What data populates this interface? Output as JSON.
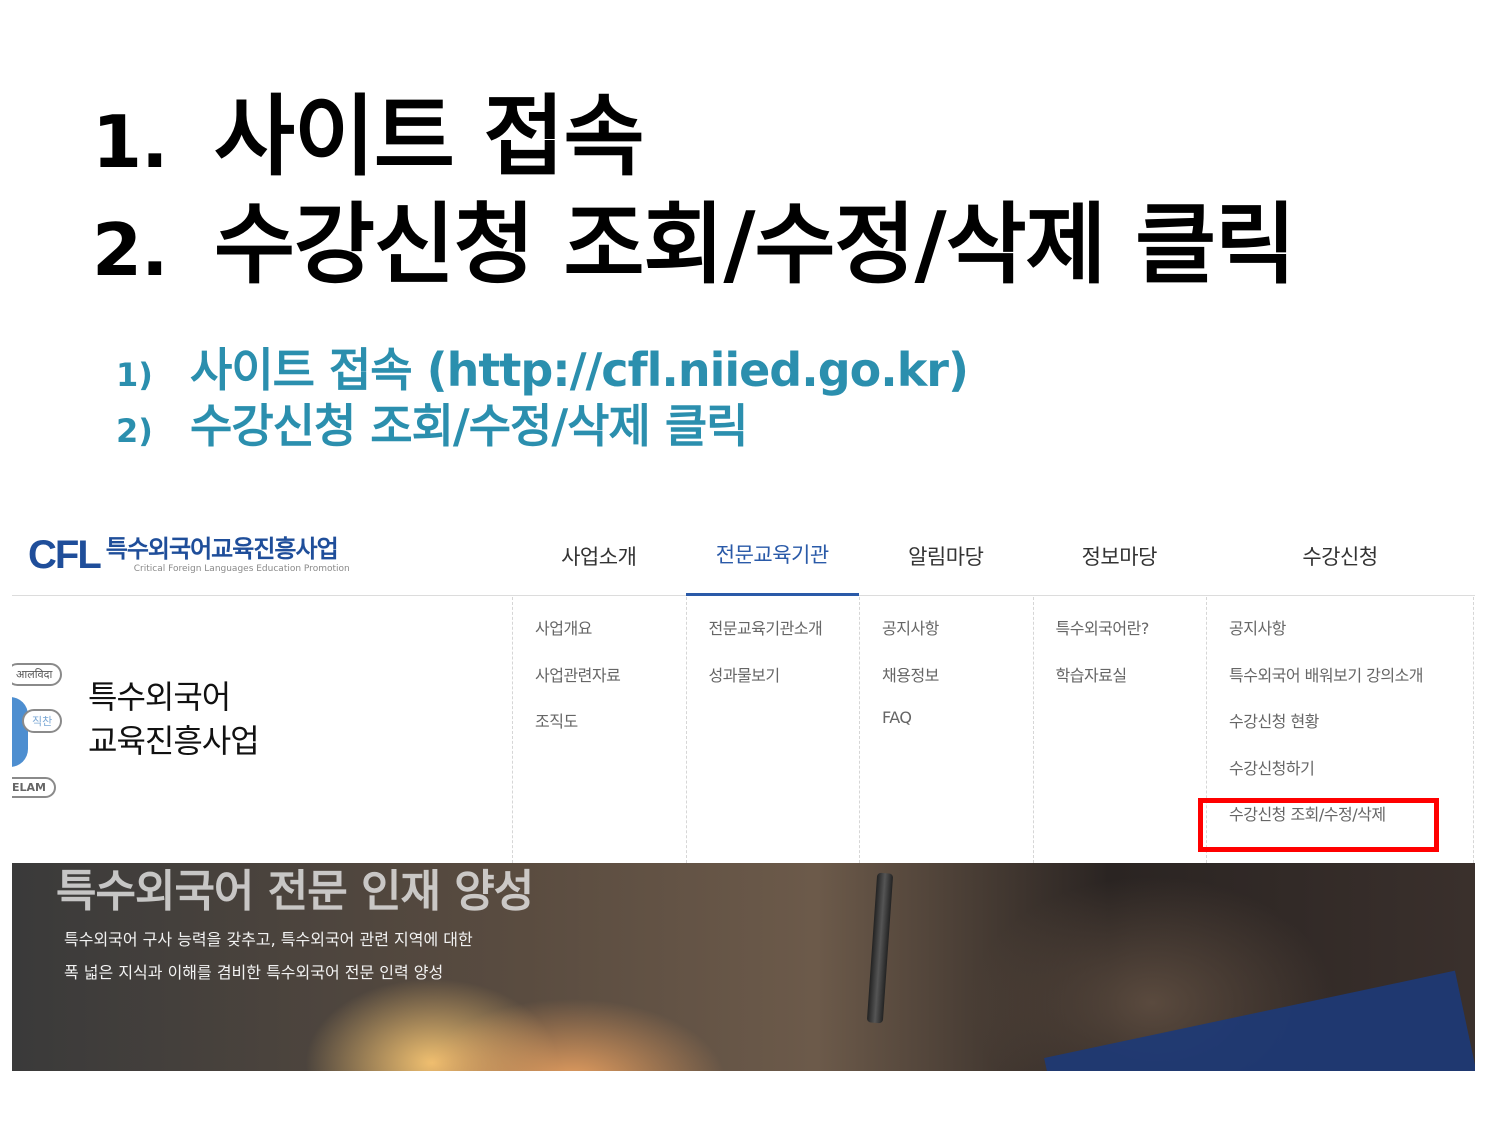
{
  "slide": {
    "steps": [
      {
        "num": "1.",
        "text": "사이트 접속"
      },
      {
        "num": "2.",
        "text": "수강신청 조회/수정/삭제 클릭"
      }
    ],
    "substeps": [
      {
        "num": "1)",
        "text": "사이트 접속 (http://cfl.niied.go.kr)"
      },
      {
        "num": "2)",
        "text": "수강신청 조회/수정/삭제 클릭"
      }
    ]
  },
  "site": {
    "logo": {
      "mark": "CFL",
      "title": "특수외국어교육진흥사업",
      "subtitle": "Critical Foreign Languages Education Promotion"
    },
    "nav": [
      {
        "label": "사업소개",
        "active": false
      },
      {
        "label": "전문교육기관",
        "active": true
      },
      {
        "label": "알림마당",
        "active": false
      },
      {
        "label": "정보마당",
        "active": false
      },
      {
        "label": "수강신청",
        "active": false
      }
    ],
    "mega_menu": {
      "title_line1": "특수외국어",
      "title_line2": "교육진흥사업",
      "bubbles": [
        "आलविदा",
        "직찬",
        "ELAM"
      ],
      "columns": [
        [
          "사업개요",
          "사업관련자료",
          "조직도"
        ],
        [
          "전문교육기관소개",
          "성과물보기"
        ],
        [
          "공지사항",
          "채용정보",
          "FAQ"
        ],
        [
          "특수외국어란?",
          "학습자료실"
        ],
        [
          "공지사항",
          "특수외국어 배워보기 강의소개",
          "수강신청 현황",
          "수강신청하기",
          "수강신청 조회/수정/삭제"
        ]
      ]
    },
    "hero": {
      "title": "특수외국어 전문 인재 양성",
      "desc_line1": "특수외국어 구사 능력을 갖추고, 특수외국어 관련 지역에 대한",
      "desc_line2": "폭 넓은 지식과 이해를 겸비한 특수외국어 전문 인력 양성"
    },
    "colors": {
      "brand": "#1f4e9a",
      "accent_text": "#2b8fae",
      "highlight_box": "#ff0000"
    }
  }
}
